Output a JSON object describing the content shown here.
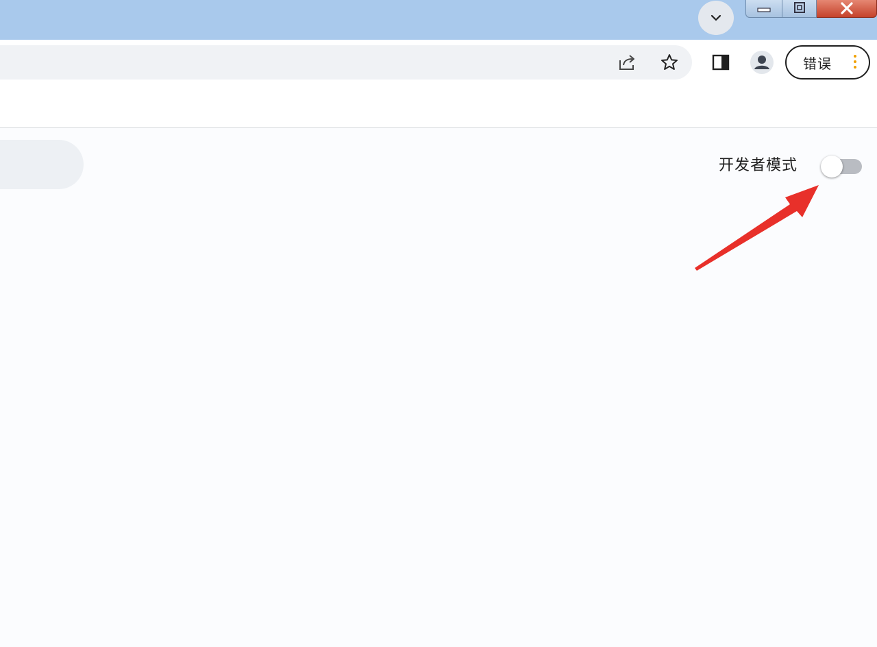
{
  "colors": {
    "titlebar": "#a9c9ec",
    "accent_arrow": "#e8302a",
    "kebab": "#f0a000"
  },
  "titlebar": {
    "tab_search_icon": "chevron-down-icon",
    "window_controls": [
      "minimize-icon",
      "restore-icon",
      "close-icon"
    ]
  },
  "toolbar": {
    "share_icon": "share-icon",
    "bookmark_icon": "star-icon",
    "side_panel_icon": "side-panel-icon",
    "profile_icon": "profile-icon",
    "error_label": "错误",
    "menu_icon": "kebab-menu-icon"
  },
  "content": {
    "developer_mode_label": "开发者模式",
    "developer_mode_on": false
  }
}
